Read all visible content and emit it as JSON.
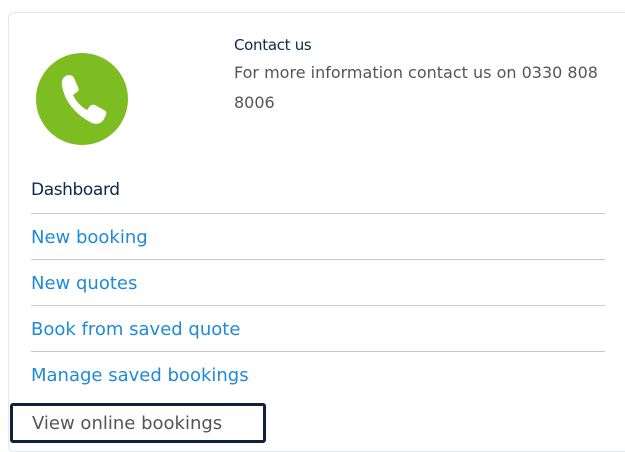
{
  "contact": {
    "title": "Contact us",
    "text": "For more information contact us on 0330 808 8006",
    "icon": "phone-icon",
    "icon_color": "#7dbd22"
  },
  "dashboard": {
    "heading": "Dashboard",
    "items": [
      {
        "label": "New booking"
      },
      {
        "label": "New quotes"
      },
      {
        "label": "Book from saved quote"
      },
      {
        "label": "Manage saved bookings"
      },
      {
        "label": "View online bookings"
      }
    ]
  },
  "colors": {
    "link": "#1f8ad6",
    "heading": "#0b2a4e",
    "focus_outline": "#10203f"
  }
}
